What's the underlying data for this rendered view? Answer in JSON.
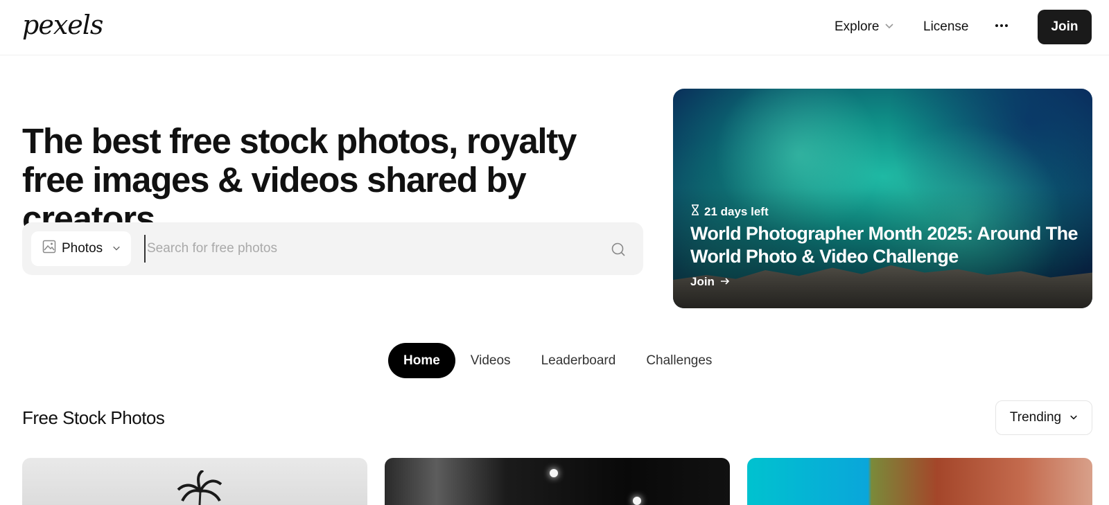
{
  "header": {
    "logo": "pexels",
    "nav": {
      "explore": "Explore",
      "license": "License",
      "join": "Join"
    }
  },
  "hero": {
    "title": "The best free stock photos, royalty free images & videos shared by creators.",
    "search": {
      "type_label": "Photos",
      "placeholder": "Search for free photos"
    }
  },
  "challenge": {
    "days_left": "21 days left",
    "title": "World Photographer Month 2025: Around The World Photo & Video Challenge",
    "cta": "Join"
  },
  "tabs": [
    {
      "label": "Home",
      "active": true
    },
    {
      "label": "Videos",
      "active": false
    },
    {
      "label": "Leaderboard",
      "active": false
    },
    {
      "label": "Challenges",
      "active": false
    }
  ],
  "section": {
    "title": "Free Stock Photos",
    "sort_label": "Trending"
  },
  "colors": {
    "primary_dark": "#1a1a1a",
    "search_bg": "#f3f3f3",
    "challenge_teal": "#0f8e86"
  },
  "icons": {
    "nav_more": "more-horizontal-icon",
    "search": "search-icon",
    "photo_type": "image-icon",
    "hourglass": "hourglass-icon",
    "arrow": "arrow-right-icon",
    "chevron": "chevron-down-icon"
  }
}
